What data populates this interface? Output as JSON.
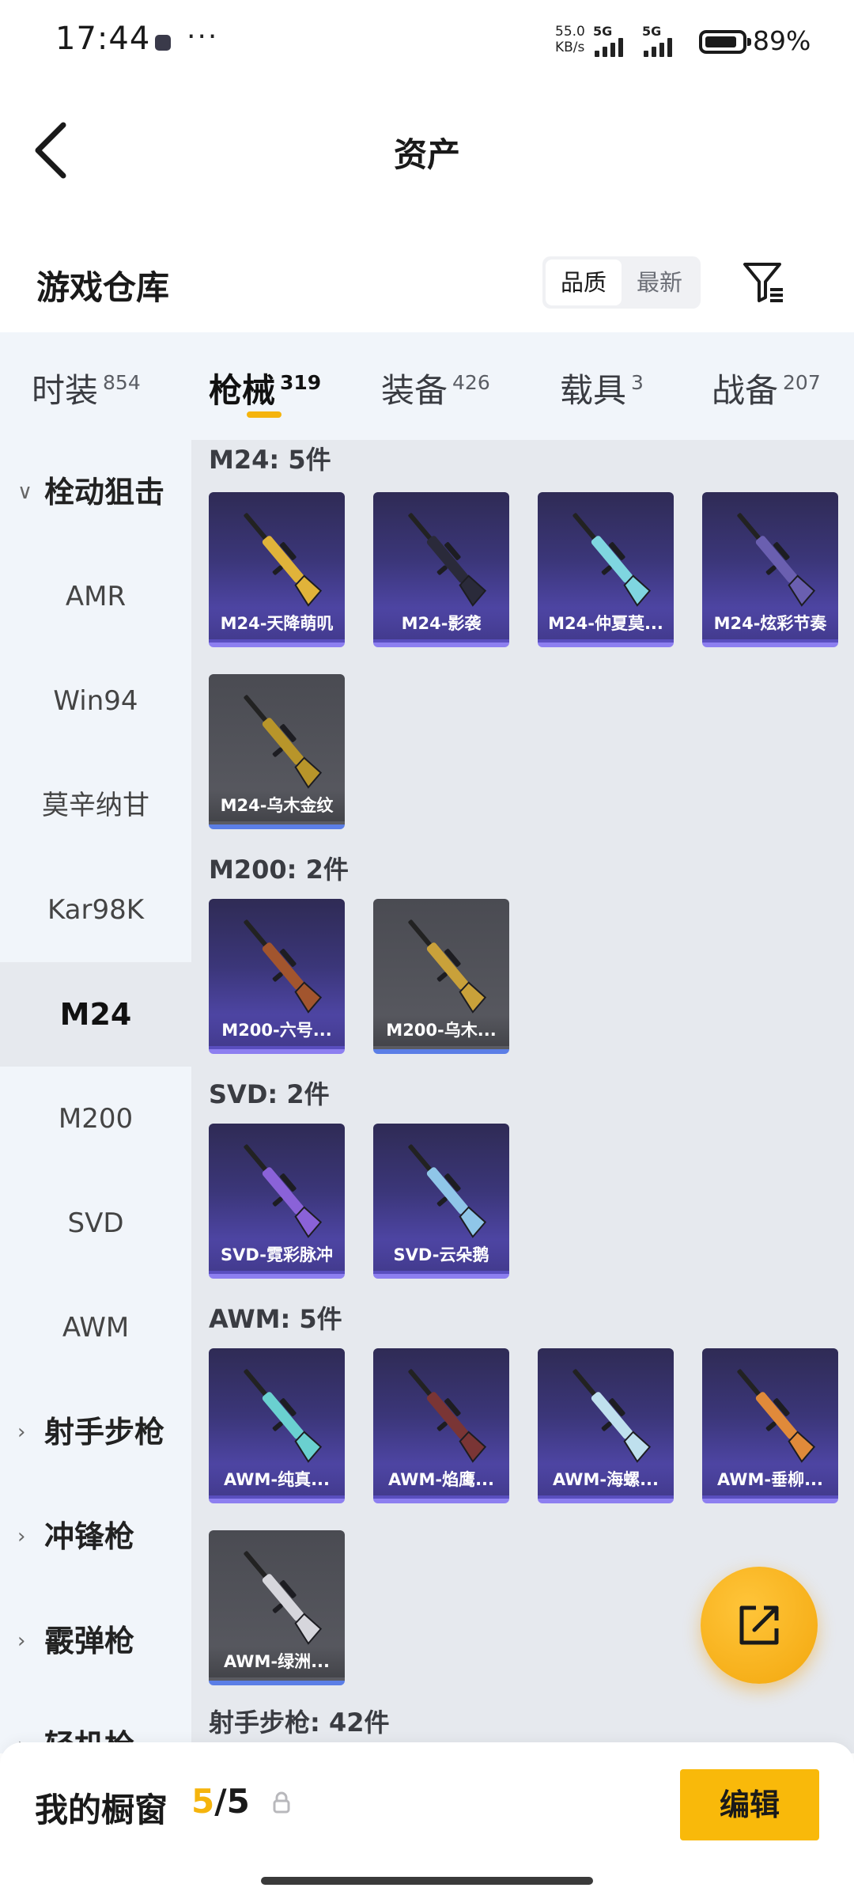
{
  "status_bar": {
    "time": "17:44",
    "dots": "···",
    "net_speed_value": "55.0",
    "net_speed_unit": "KB/s",
    "signal_1": "5G",
    "signal_2": "5G",
    "battery_percent_text": "89%",
    "battery_level": 0.89
  },
  "header": {
    "title": "资产",
    "back_icon": "chevron-left-icon"
  },
  "warehouse": {
    "title": "游戏仓库",
    "sort_options": [
      "品质",
      "最新"
    ],
    "sort_selected": "品质",
    "filter_icon": "filter-icon"
  },
  "tabs": [
    {
      "label": "时装",
      "count": "854"
    },
    {
      "label": "枪械",
      "count": "319",
      "active": true
    },
    {
      "label": "装备",
      "count": "426"
    },
    {
      "label": "载具",
      "count": "3"
    },
    {
      "label": "战备",
      "count": "207"
    }
  ],
  "sidebar": {
    "items": [
      {
        "label": "栓动狙击",
        "type": "group",
        "expanded": true
      },
      {
        "label": "AMR"
      },
      {
        "label": "Win94"
      },
      {
        "label": "莫辛纳甘"
      },
      {
        "label": "Kar98K"
      },
      {
        "label": "M24",
        "selected": true
      },
      {
        "label": "M200"
      },
      {
        "label": "SVD"
      },
      {
        "label": "AWM"
      },
      {
        "label": "射手步枪",
        "type": "group"
      },
      {
        "label": "冲锋枪",
        "type": "group"
      },
      {
        "label": "霰弹枪",
        "type": "group"
      },
      {
        "label": "轻机枪",
        "type": "group"
      }
    ]
  },
  "sections": [
    {
      "title": "M24: 5件",
      "items": [
        {
          "name": "M24-天降萌叽",
          "rarity": "purple",
          "gun_color": "#e0b33a"
        },
        {
          "name": "M24-影袭",
          "rarity": "purple",
          "gun_color": "#2a2a3a"
        },
        {
          "name": "M24-仲夏莫...",
          "rarity": "purple",
          "gun_color": "#7fd6e0"
        },
        {
          "name": "M24-炫彩节奏",
          "rarity": "purple",
          "gun_color": "#6a5fb0"
        },
        {
          "name": "M24-乌木金纹",
          "rarity": "grey",
          "gun_color": "#b8952a"
        }
      ]
    },
    {
      "title": "M200: 2件",
      "items": [
        {
          "name": "M200-六号...",
          "rarity": "purple",
          "gun_color": "#a2552e"
        },
        {
          "name": "M200-乌木...",
          "rarity": "grey",
          "gun_color": "#c9a13a"
        }
      ]
    },
    {
      "title": "SVD: 2件",
      "items": [
        {
          "name": "SVD-霓彩脉冲",
          "rarity": "purple",
          "gun_color": "#8a62d8"
        },
        {
          "name": "SVD-云朵鹅",
          "rarity": "purple",
          "gun_color": "#8fc6e8"
        }
      ]
    },
    {
      "title": "AWM: 5件",
      "items": [
        {
          "name": "AWM-纯真...",
          "rarity": "purple",
          "gun_color": "#6ad0d0"
        },
        {
          "name": "AWM-焰鹰...",
          "rarity": "purple",
          "gun_color": "#7a3535"
        },
        {
          "name": "AWM-海螺...",
          "rarity": "purple",
          "gun_color": "#bfe0ee"
        },
        {
          "name": "AWM-垂柳...",
          "rarity": "purple",
          "gun_color": "#e08a3a"
        },
        {
          "name": "AWM-绿洲...",
          "rarity": "grey",
          "gun_color": "#d6d6dc"
        }
      ]
    },
    {
      "title": "射手步枪: 42件",
      "items": []
    }
  ],
  "fab": {
    "icon": "share-icon"
  },
  "bottom": {
    "showcase_label": "我的橱窗",
    "showcase_current": "5",
    "showcase_sep_total": "/5",
    "lock_icon": "lock-icon",
    "edit_label": "编辑"
  },
  "colors": {
    "accent": "#f5b40d",
    "purple_card": "#3b3679",
    "grey_card": "#55565c"
  }
}
